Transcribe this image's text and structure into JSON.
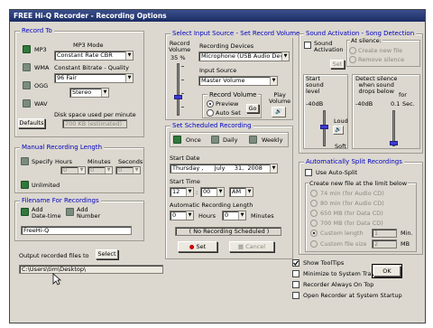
{
  "title": "FREE Hi-Q Recorder - Recording Options",
  "record_to": {
    "title": "Record To",
    "formats": [
      "MP3",
      "WMA",
      "OGG",
      "WAV"
    ],
    "mp3_mode_label": "MP3 Mode",
    "mp3_mode_value": "Constant Rate CBR",
    "bitrate_label": "Constant Bitrate - Quality",
    "bitrate_value": "96  Fair",
    "channels_value": "Stereo",
    "disk_space_label": "Disk space used per minute",
    "disk_space_value": "700  KB (estimated)",
    "defaults_label": "Defaults"
  },
  "manual_length": {
    "title": "Manual Recording Length",
    "specify_label": "Specify",
    "hours_label": "Hours",
    "minutes_label": "Minutes",
    "seconds_label": "Seconds",
    "hours_value": "0",
    "minutes_value": "0",
    "seconds_value": "0",
    "unlimited_label": "Unlimited"
  },
  "filename": {
    "title": "Filename For Recordings",
    "add_datetime_label": "Add\nDate-time",
    "add_number_label": "Add\nNumber",
    "value": "FreeHi-Q"
  },
  "output": {
    "label": "Output recorded files to",
    "select_label": "Select",
    "path": "C:\\Users\\tim\\Desktop\\"
  },
  "source": {
    "title": "Select Input Source - Set Record Volume",
    "volume_label": "Record\nVolume",
    "volume_value": "35 %",
    "volume_level": 0.35,
    "devices_label": "Recording Devices",
    "device_value": "Microphone (USB Audio Dev",
    "input_label": "Input Source",
    "input_value": "Master Volume",
    "rec_volume_label": "Record Volume",
    "preview_label": "Preview",
    "autoset_label": "Auto Set",
    "go_label": "Go",
    "play_volume_label": "Play\nVolume"
  },
  "schedule": {
    "title": "Set Scheduled Recording",
    "once_label": "Once",
    "daily_label": "Daily",
    "weekly_label": "Weekly",
    "start_date_label": "Start Date",
    "date_day": "Thursday",
    "date_month": "July",
    "date_dom": "31,",
    "date_year": "2008",
    "start_time_label": "Start Time",
    "hour_value": "12",
    "minute_value": "00",
    "ampm_value": "AM",
    "auto_length_label": "Automatic Recording Length",
    "hours_value": "0",
    "hours_label": "Hours",
    "minutes_value": "0",
    "minutes_label": "Minutes",
    "status": "( No Recording Scheduled )",
    "set_label": "Set",
    "cancel_label": "Cancel"
  },
  "activation": {
    "title": "Sound Activation - Song Detection",
    "sound_activation_label": "Sound\nActivation",
    "at_silence_label": "At silence:",
    "create_new_file_label": "Create new file",
    "remove_silence_label": "Remove silence",
    "set_label": "Set",
    "start_level_label": "Start\nsound\nlevel",
    "start_level_value": "-40dB",
    "detect_silence_label": "Detect silence\nwhen sound\ndrops below",
    "detect_level_value": "-40dB",
    "for_label": "for",
    "duration_value": "0.1",
    "seconds_unit": "Sec.",
    "loud_label": "Loud",
    "soft_label": "Soft"
  },
  "auto_split": {
    "title": "Automatically Split Recordings",
    "auto_split_label": "Use Auto-Split",
    "create_new_label": "Create new file at the limit below",
    "options": [
      "74 min  (for Audio CD)",
      "80 min  (for Audio CD)",
      "650 MB  (for Data CD)",
      "700 MB  (for Data CD)"
    ],
    "custom_length_label": "Custom length",
    "custom_length_value": "1",
    "custom_length_unit": "Min.",
    "custom_size_label": "Custom file size",
    "custom_size_value": "2",
    "custom_size_unit": "MB"
  },
  "options": {
    "show_tooltips": "Show ToolTips",
    "minimize_tray": "Minimize to System Tray",
    "always_on_top": "Recorder Always On Top",
    "open_at_startup": "Open Recorder at System Startup",
    "ok_label": "OK"
  },
  "colors": {
    "group_title": "#0000c0",
    "led_on": "#2f7a3a",
    "slider_thumb": "#3c3bd6"
  }
}
